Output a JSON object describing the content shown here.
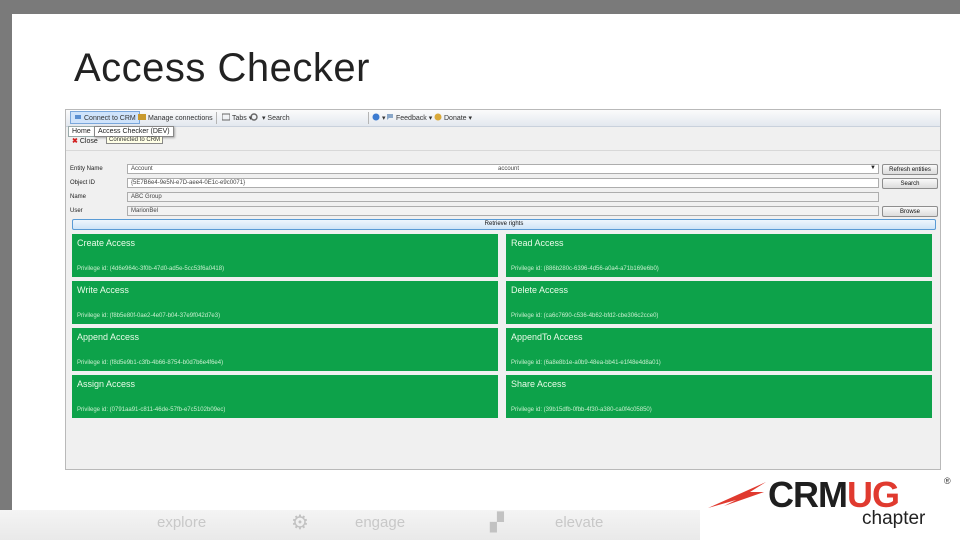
{
  "slide": {
    "title": "Access Checker"
  },
  "toolbar": {
    "connect": "Connect to CRM",
    "manage": "Manage connections",
    "tabs": "Tabs",
    "search": "Search",
    "feedback": "Feedback",
    "donate": "Donate"
  },
  "tabs": {
    "home": "Home",
    "access_checker": "Access Checker (DEV)",
    "tooltip": "Connected to CRM",
    "close": "Close"
  },
  "form": {
    "entity_label": "Entity Name",
    "entity_value": "Account",
    "entity_value_2": "account",
    "refresh_button": "Refresh entities",
    "objectid_label": "Object ID",
    "objectid_value": "{5E7B6e4-9e5N-e7D-aee4-0E1c-e9c0071}",
    "search_button": "Search",
    "name_label": "Name",
    "name_value": "ABC Group",
    "user_label": "User",
    "user_value": "MarionBel",
    "browse_button": "Browse",
    "retrieve_button": "Retrieve rights"
  },
  "rights": [
    {
      "title": "Create Access",
      "privilege": "Privilege id: (4d6e964c-3f0b-47d0-ad5e-5cc53f6a0418)"
    },
    {
      "title": "Read Access",
      "privilege": "Privilege id: (886b280c-6396-4d56-a0a4-a71b169e6b0)"
    },
    {
      "title": "Write Access",
      "privilege": "Privilege id: (f8b5e80f-0ae2-4e07-b04-37e9f042d7e3)"
    },
    {
      "title": "Delete Access",
      "privilege": "Privilege id: (ca6c7690-c536-4b62-bfd2-cbe306c2cce0)"
    },
    {
      "title": "Append Access",
      "privilege": "Privilege id: (f8d5e9b1-c3fb-4b66-8754-b0d7b6e4f6e4)"
    },
    {
      "title": "AppendTo Access",
      "privilege": "Privilege id: (6a8e8b1e-a0b9-48ea-bb41-e1f48e4d8a01)"
    },
    {
      "title": "Assign Access",
      "privilege": "Privilege id: (0791aa91-c811-46de-57fb-e7c5102b09ec)"
    },
    {
      "title": "Share Access",
      "privilege": "Privilege id: (39b15dfb-0fbb-4f30-a380-ca0f4c05850)"
    }
  ],
  "footer": {
    "explore": "explore",
    "engage": "engage",
    "elevate": "elevate"
  },
  "logo": {
    "main": "CRM",
    "accent": "UG",
    "reg": "®",
    "sub": "chapter"
  },
  "colors": {
    "cell_green": "#0da24a",
    "accent_red": "#e03a2f"
  }
}
